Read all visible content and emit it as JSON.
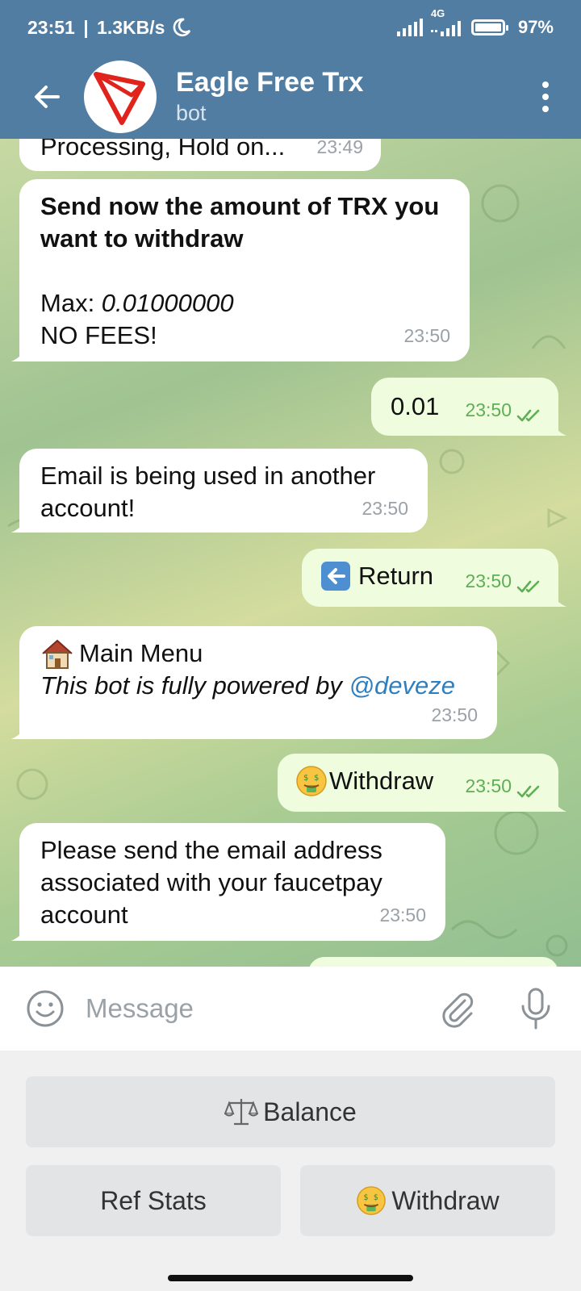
{
  "status_bar": {
    "time": "23:51",
    "net_speed": "1.3KB/s",
    "network": "4G",
    "battery": "97%"
  },
  "header": {
    "title": "Eagle Free Trx",
    "subtitle": "bot",
    "avatar_icon": "tron-logo-icon"
  },
  "messages": [
    {
      "dir": "in",
      "text": "Processing, Hold on...",
      "time": "23:49"
    },
    {
      "dir": "in",
      "line1": "Send now the amount of TRX you",
      "line2": "want to withdraw",
      "max_label": "Max: ",
      "max_value": "0.01000000",
      "note": "NO FEES!",
      "time": "23:50"
    },
    {
      "dir": "out",
      "text": "0.01",
      "time": "23:50"
    },
    {
      "dir": "in",
      "line1": "Email is being used in another",
      "line2": "account!",
      "time": "23:50"
    },
    {
      "dir": "out",
      "text": "Return",
      "time": "23:50"
    },
    {
      "dir": "in",
      "title": "Main Menu",
      "caption": "This bot is fully powered by ",
      "link": "@deveze",
      "time": "23:50"
    },
    {
      "dir": "out",
      "text": "Withdraw",
      "time": "23:50"
    },
    {
      "dir": "in",
      "line1": "Please send the email address",
      "line2": "associated with your faucetpay",
      "line3": "account",
      "time": "23:50"
    }
  ],
  "composer": {
    "placeholder": "Message"
  },
  "keyboard": {
    "balance": "Balance",
    "ref_stats": "Ref Stats",
    "withdraw": "Withdraw"
  },
  "colors": {
    "header": "#517da2",
    "incoming_bubble": "#ffffff",
    "outgoing_bubble": "#effdde",
    "check_green": "#5fae55",
    "link": "#2f7fbf"
  }
}
